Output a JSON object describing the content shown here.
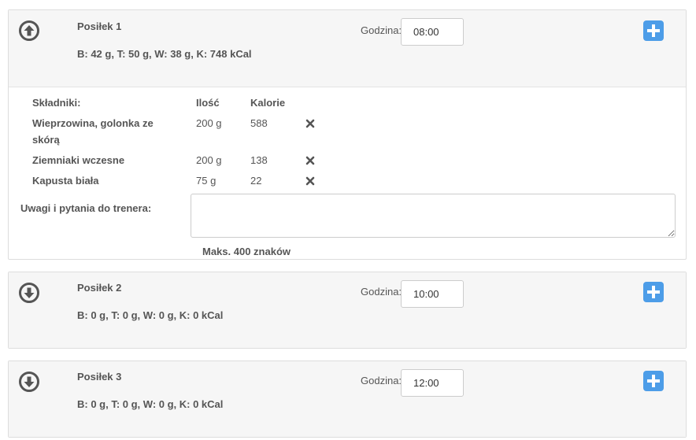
{
  "colors": {
    "accent": "#4d9de8",
    "icon": "#555555",
    "panel_bg": "#f6f6f6"
  },
  "time_label": "Godzina:",
  "meals": [
    {
      "title": "Posiłek 1",
      "macros": "B: 42 g, T: 50 g, W: 38 g, K: 748 kCal",
      "time": "08:00",
      "expanded": true,
      "toggle_icon": "arrow-up-circle-icon"
    },
    {
      "title": "Posiłek 2",
      "macros": "B: 0 g, T: 0 g, W: 0 g, K: 0 kCal",
      "time": "10:00",
      "expanded": false,
      "toggle_icon": "arrow-down-circle-icon"
    },
    {
      "title": "Posiłek 3",
      "macros": "B: 0 g, T: 0 g, W: 0 g, K: 0 kCal",
      "time": "12:00",
      "expanded": false,
      "toggle_icon": "arrow-down-circle-icon"
    }
  ],
  "ingredients": {
    "headers": {
      "name": "Składniki:",
      "qty": "Ilość",
      "cal": "Kalorie"
    },
    "rows": [
      {
        "name": "Wieprzowina, golonka ze skórą",
        "qty": "200 g",
        "cal": "588"
      },
      {
        "name": "Ziemniaki wczesne",
        "qty": "200 g",
        "cal": "138"
      },
      {
        "name": "Kapusta biała",
        "qty": "75 g",
        "cal": "22"
      }
    ]
  },
  "notes": {
    "label": "Uwagi i pytania do trenera:",
    "value": "",
    "max_hint": "Maks. 400 znaków"
  }
}
